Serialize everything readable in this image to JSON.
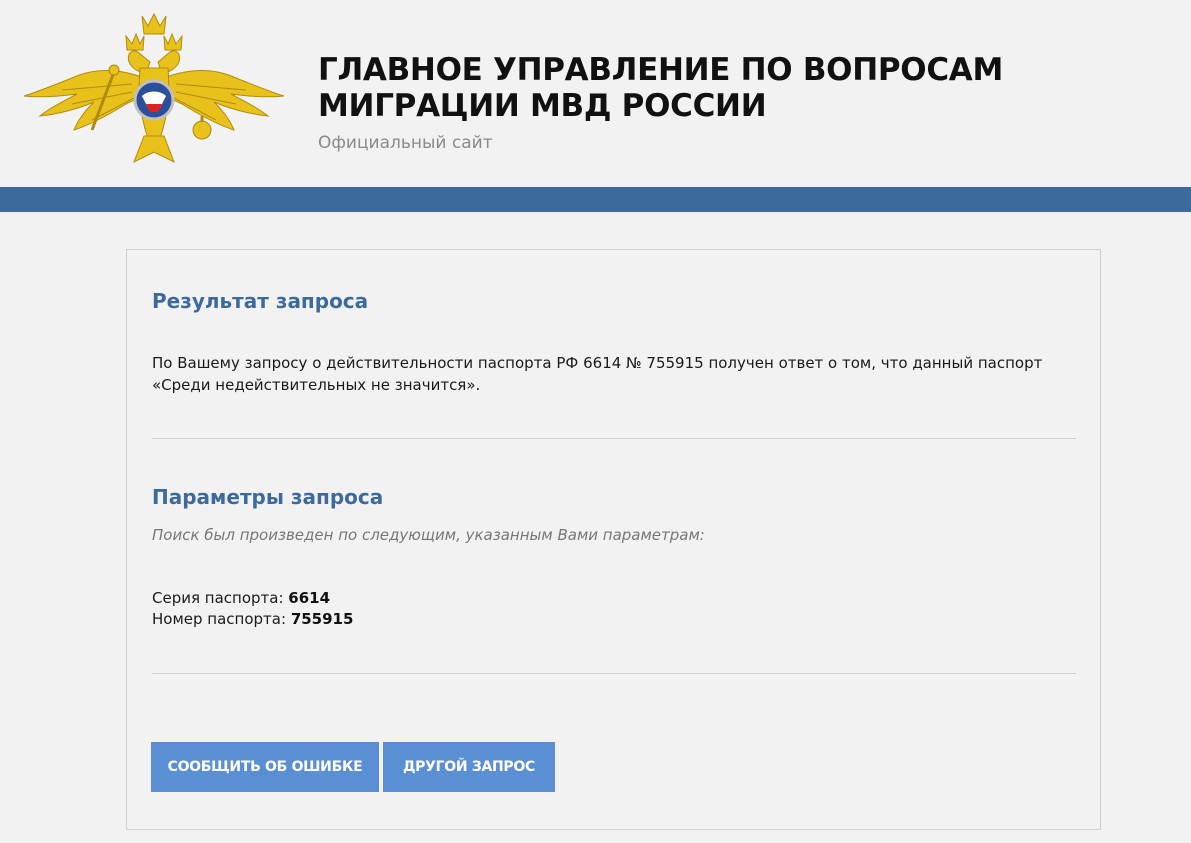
{
  "header": {
    "title": "ГЛАВНОЕ УПРАВЛЕНИЕ ПО ВОПРОСАМ\nМИГРАЦИИ МВД РОССИИ",
    "subtitle": "Официальный сайт",
    "emblem_icon": "double-headed-eagle-emblem-icon"
  },
  "colors": {
    "accent": "#3d6a9d",
    "button": "#5b8fd4",
    "background": "#f2f2f2",
    "gold": "#e8c21a"
  },
  "result": {
    "heading": "Результат запроса",
    "text": "По Вашему запросу о действительности паспорта РФ 6614 № 755915 получен ответ о том, что данный паспорт «Среди недействительных не значится»."
  },
  "params": {
    "heading": "Параметры запроса",
    "note": "Поиск был произведен по следующим, указанным Вами параметрам:",
    "series_label": "Серия паспорта:",
    "series_value": "6614",
    "number_label": "Номер паспорта:",
    "number_value": "755915"
  },
  "buttons": {
    "report_error": "СООБЩИТЬ ОБ ОШИБКЕ",
    "another_request": "ДРУГОЙ ЗАПРОС"
  }
}
